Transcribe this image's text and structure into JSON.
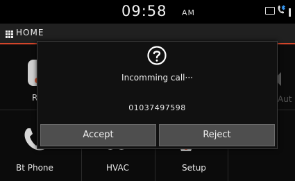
{
  "status_bar": {
    "time": "09:58",
    "ampm": "AM",
    "icons": [
      "battery-icon",
      "bluetooth-phone-icon",
      "signal-icon"
    ]
  },
  "home_bar": {
    "label": "HOME",
    "icon": "grid-menu-icon"
  },
  "accent_color": "#d2452a",
  "grid": {
    "tiles": [
      {
        "label": "R",
        "icon": "radio-icon"
      },
      {
        "label": "",
        "icon": "media-icon"
      },
      {
        "label": "",
        "icon": "navigation-icon"
      },
      {
        "label": "Aut",
        "icon": "audio-icon"
      },
      {
        "label": "Bt Phone",
        "icon": "phone-icon"
      },
      {
        "label": "HVAC",
        "icon": "fan-icon"
      },
      {
        "label": "Setup",
        "icon": "gear-icon"
      },
      {
        "label": "",
        "icon": ""
      }
    ]
  },
  "popup": {
    "icon": "question-icon",
    "message": "Incomming call···",
    "number": "01037497598",
    "accept_label": "Accept",
    "reject_label": "Reject"
  }
}
